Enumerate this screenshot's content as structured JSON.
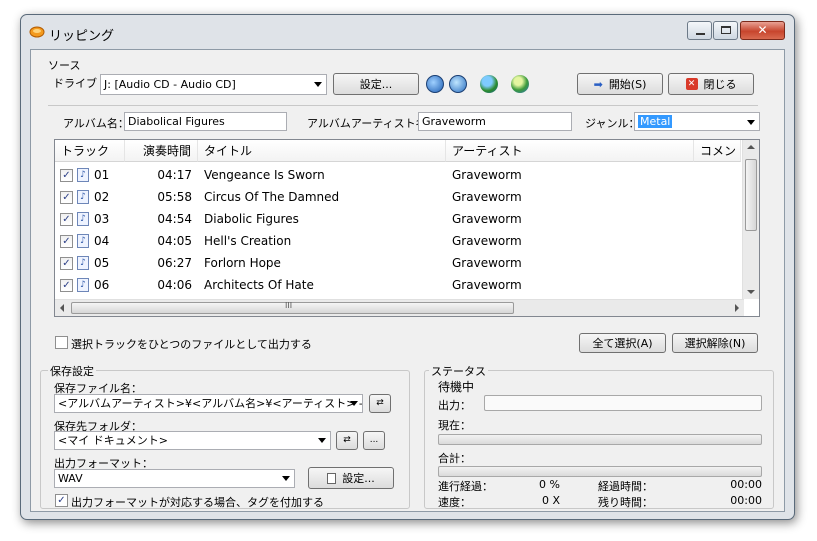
{
  "window": {
    "title": "リッピング"
  },
  "source": {
    "group_label": "ソース",
    "drive_label": "ドライブ",
    "drive_value": "J:  [Audio CD - Audio CD]",
    "settings_button": "設定...",
    "start_button": "開始(S)",
    "close_button": "閉じる",
    "album_label": "アルバム名：",
    "album_value": "Diabolical Figures",
    "album_artist_label": "アルバムアーティスト名：",
    "album_artist_value": "Graveworm",
    "genre_label": "ジャンル：",
    "genre_value": "Metal"
  },
  "tracklist": {
    "headers": [
      "トラック",
      "演奏時間",
      "タイトル",
      "アーティスト",
      "コメン"
    ],
    "rows": [
      {
        "track": "01",
        "time": "04:17",
        "title": "Vengeance Is Sworn",
        "artist": "Graveworm"
      },
      {
        "track": "02",
        "time": "05:58",
        "title": "Circus Of The Damned",
        "artist": "Graveworm"
      },
      {
        "track": "03",
        "time": "04:54",
        "title": "Diabolic Figures",
        "artist": "Graveworm"
      },
      {
        "track": "04",
        "time": "04:05",
        "title": "Hell's Creation",
        "artist": "Graveworm"
      },
      {
        "track": "05",
        "time": "06:27",
        "title": "Forlorn Hope",
        "artist": "Graveworm"
      },
      {
        "track": "06",
        "time": "04:06",
        "title": "Architects Of Hate",
        "artist": "Graveworm"
      }
    ],
    "scroll_grip": "III"
  },
  "options": {
    "single_file_label": "選択トラックをひとつのファイルとして出力する",
    "select_all_button": "全て選択(A)",
    "deselect_button": "選択解除(N)"
  },
  "save": {
    "group_label": "保存設定",
    "filename_label": "保存ファイル名：",
    "filename_value": "<アルバムアーティスト>¥<アルバム名>¥<アーティスト> - <アルバ",
    "folder_label": "保存先フォルダ：",
    "folder_value": "<マイ  ドキュメント>",
    "browse_button": "...",
    "format_label": "出力フォーマット：",
    "format_value": "WAV",
    "format_settings_button": "設定...",
    "tag_label": "出力フォーマットが対応する場合、タグを付加する"
  },
  "status": {
    "group_label": "ステータス",
    "state": "待機中",
    "output_label": "出力：",
    "current_label": "現在：",
    "total_label": "合計：",
    "progress_label": "進行経過：",
    "progress_value": "0 %",
    "elapsed_label": "経過時間：",
    "elapsed_value": "00:00",
    "speed_label": "速度：",
    "speed_value": "0 X",
    "remaining_label": "残り時間：",
    "remaining_value": "00:00"
  }
}
